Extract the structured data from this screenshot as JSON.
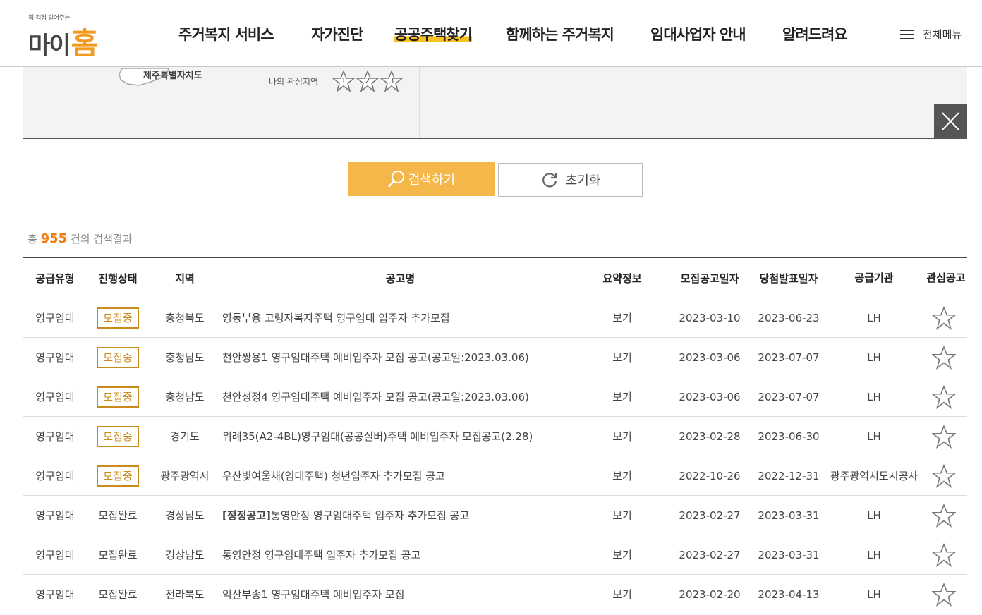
{
  "header": {
    "logo_tagline": "집 걱정 덜어주는",
    "logo_text": "마이",
    "logo_home": "홈",
    "nav": [
      "주거복지 서비스",
      "자가진단",
      "공공주택찾기",
      "함께하는 주거복지",
      "임대사업자 안내",
      "알려드려요"
    ],
    "all_menu": "전체메뉴"
  },
  "map": {
    "jeju_label": "제주특별자치도",
    "fav_region_label": "나의 관심지역",
    "star_numbers": [
      "1",
      "2",
      "3"
    ]
  },
  "buttons": {
    "search": "검색하기",
    "reset": "초기화"
  },
  "results": {
    "prefix": "총",
    "count": "955",
    "suffix": "건의 검색결과"
  },
  "table": {
    "headers": {
      "type": "공급유형",
      "status": "진행상태",
      "region": "지역",
      "title": "공고명",
      "summary": "요약정보",
      "post_date": "모집공고일자",
      "win_date": "당첨발표일자",
      "agency": "공급기관",
      "fav": "관심공고"
    },
    "rows": [
      {
        "type": "영구임대",
        "status": "모집중",
        "region": "충청북도",
        "prefix": "",
        "title": "영동부용 고령자복지주택 영구임대 입주자 추가모집",
        "summary": "보기",
        "post_date": "2023-03-10",
        "win_date": "2023-06-23",
        "agency": "LH"
      },
      {
        "type": "영구임대",
        "status": "모집중",
        "region": "충청남도",
        "prefix": "",
        "title": "천안쌍용1 영구임대주택 예비입주자 모집 공고(공고일:2023.03.06)",
        "summary": "보기",
        "post_date": "2023-03-06",
        "win_date": "2023-07-07",
        "agency": "LH"
      },
      {
        "type": "영구임대",
        "status": "모집중",
        "region": "충청남도",
        "prefix": "",
        "title": "천안성정4 영구임대주택 예비입주자 모집 공고(공고일:2023.03.06)",
        "summary": "보기",
        "post_date": "2023-03-06",
        "win_date": "2023-07-07",
        "agency": "LH"
      },
      {
        "type": "영구임대",
        "status": "모집중",
        "region": "경기도",
        "prefix": "",
        "title": "위례35(A2-4BL)영구임대(공공실버)주택 예비입주자 모집공고(2.28)",
        "summary": "보기",
        "post_date": "2023-02-28",
        "win_date": "2023-06-30",
        "agency": "LH"
      },
      {
        "type": "영구임대",
        "status": "모집중",
        "region": "광주광역시",
        "prefix": "",
        "title": "우산빛여울채(임대주택) 청년입주자 추가모집 공고",
        "summary": "보기",
        "post_date": "2022-10-26",
        "win_date": "2022-12-31",
        "agency": "광주광역시도시공사"
      },
      {
        "type": "영구임대",
        "status": "모집완료",
        "region": "경상남도",
        "prefix": "[정정공고]",
        "title": "통영안정 영구임대주택 입주자 추가모집 공고",
        "summary": "보기",
        "post_date": "2023-02-27",
        "win_date": "2023-03-31",
        "agency": "LH"
      },
      {
        "type": "영구임대",
        "status": "모집완료",
        "region": "경상남도",
        "prefix": "",
        "title": "통영안정 영구임대주택 입주자 추가모집 공고",
        "summary": "보기",
        "post_date": "2023-02-27",
        "win_date": "2023-03-31",
        "agency": "LH"
      },
      {
        "type": "영구임대",
        "status": "모집완료",
        "region": "전라북도",
        "prefix": "",
        "title": "익산부송1 영구임대주택 예비입주자 모집",
        "summary": "보기",
        "post_date": "2023-02-20",
        "win_date": "2023-04-13",
        "agency": "LH"
      }
    ]
  },
  "colors": {
    "accent": "#f5b74a",
    "badge": "#c98b1c",
    "count": "#f27a0f",
    "highlight": "#f9c11d"
  }
}
